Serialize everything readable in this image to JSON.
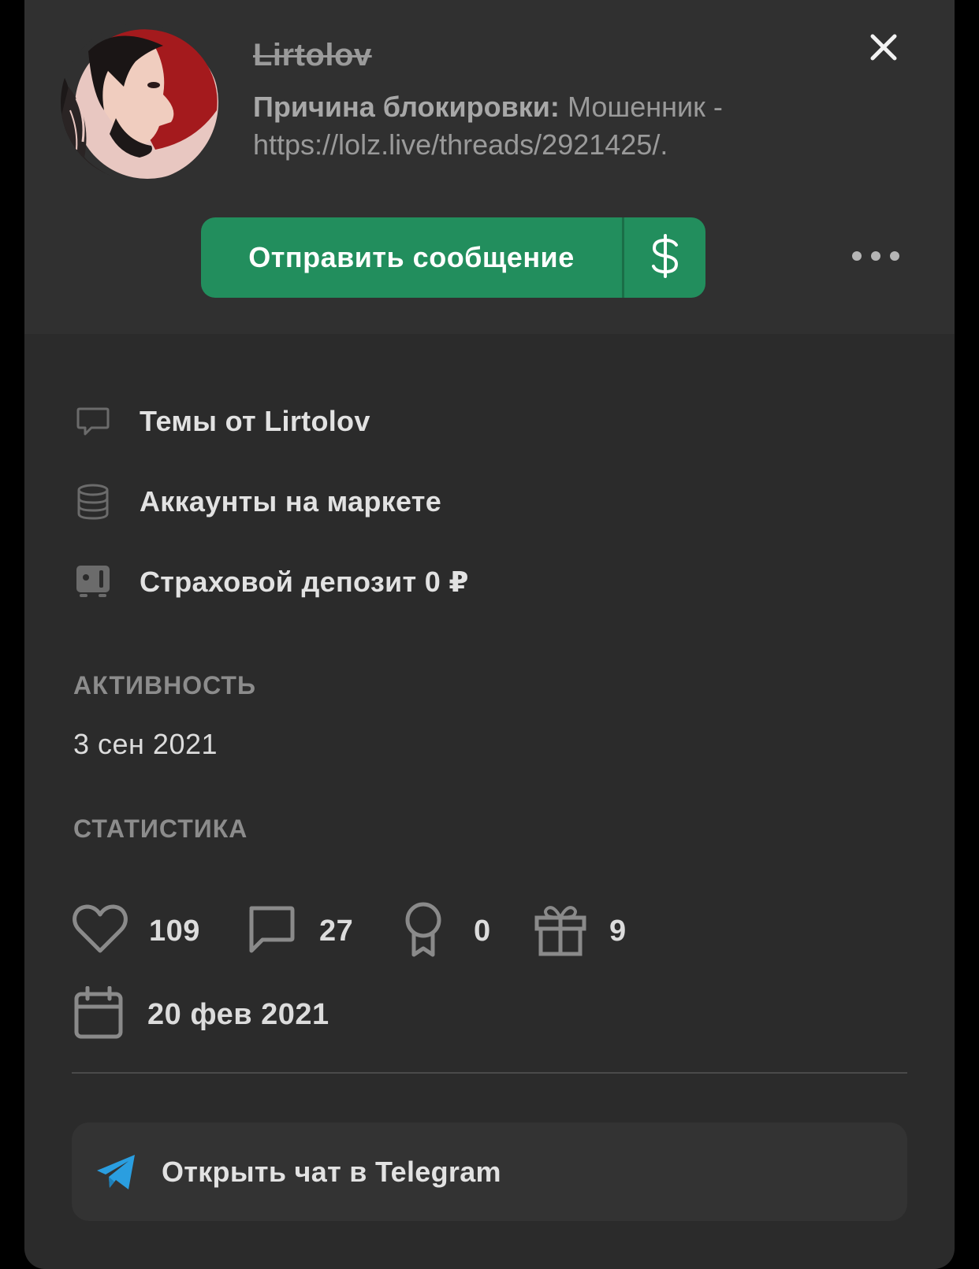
{
  "profile": {
    "username": "Lirtolov",
    "ban_label": "Причина блокировки:",
    "ban_reason": "Мошенник - https://lolz.live/threads/2921425/.",
    "avatar_icon": "avatar-illustration"
  },
  "actions": {
    "send_message_label": "Отправить сообщение",
    "money_icon": "dollar-icon",
    "more_icon": "more-dots-icon",
    "close_icon": "close-icon",
    "accent_color": "#228e5d"
  },
  "links": [
    {
      "label": "Темы от Lirtolov",
      "icon": "chat-bubble-icon"
    },
    {
      "label": "Аккаунты на маркете",
      "icon": "database-icon"
    },
    {
      "label": "Страховой депозит 0 ₽",
      "icon": "safe-icon"
    }
  ],
  "activity": {
    "title": "АКТИВНОСТЬ",
    "date": "3 сен 2021"
  },
  "statistics": {
    "title": "СТАТИСТИКА",
    "likes": "109",
    "messages": "27",
    "trophies": "0",
    "gifts": "9",
    "registered": "20 фев 2021"
  },
  "telegram": {
    "label": "Открыть чат в Telegram",
    "icon": "telegram-icon",
    "color": "#2a9ee0"
  }
}
